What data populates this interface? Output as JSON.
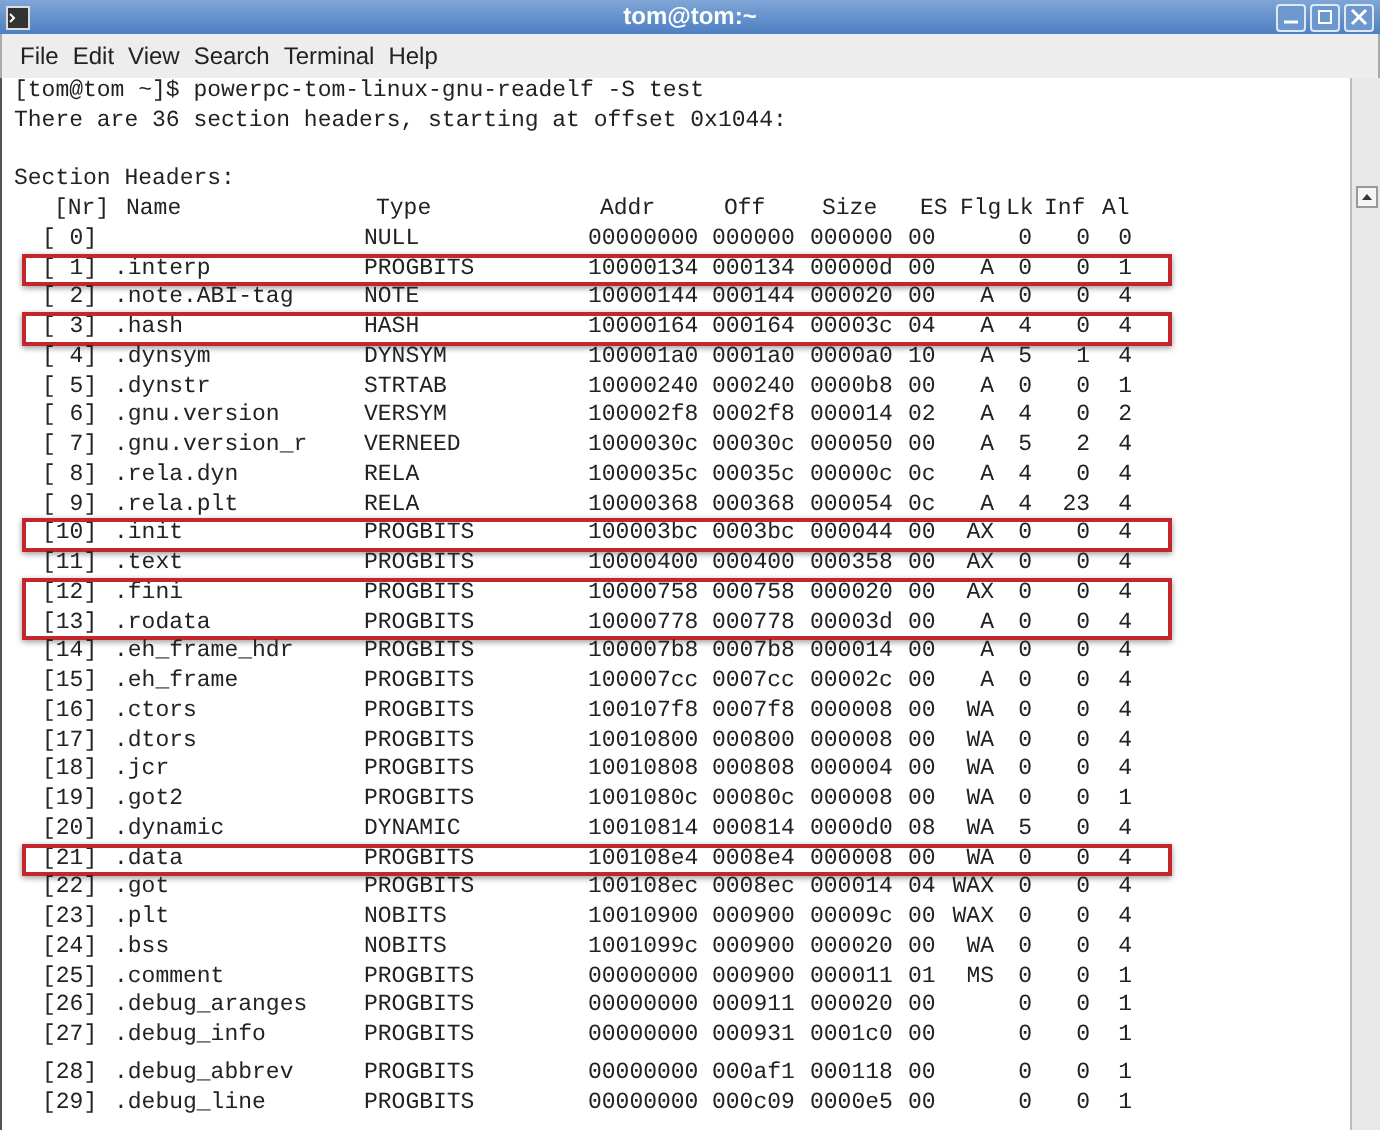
{
  "window": {
    "title": "tom@tom:~"
  },
  "menu": [
    "File",
    "Edit",
    "View",
    "Search",
    "Terminal",
    "Help"
  ],
  "terminal": {
    "output_lines": [
      "[tom@tom ~]$ powerpc-tom-linux-gnu-readelf -S test",
      "There are 36 section headers, starting at offset 0x1044:"
    ],
    "heading": "Section Headers:",
    "table": {
      "columns": [
        "[Nr]",
        "Name",
        "Type",
        "Addr",
        "Off",
        "Size",
        "ES",
        "Flg",
        "Lk",
        "Inf",
        "Al"
      ],
      "row_groups": [
        [
          {
            "cells": [
              "[ 0]",
              "",
              "NULL",
              "00000000",
              "000000",
              "000000",
              "00",
              "",
              "0",
              "0",
              "0"
            ],
            "highlighted": false
          },
          {
            "cells": [
              "[ 1]",
              ".interp",
              "PROGBITS",
              "10000134",
              "000134",
              "00000d",
              "00",
              "A",
              "0",
              "0",
              "1"
            ],
            "highlighted": true
          },
          {
            "cells": [
              "[ 2]",
              ".note.ABI-tag",
              "NOTE",
              "10000144",
              "000144",
              "000020",
              "00",
              "A",
              "0",
              "0",
              "4"
            ],
            "highlighted": false
          },
          {
            "cells": [
              "[ 3]",
              ".hash",
              "HASH",
              "10000164",
              "000164",
              "00003c",
              "04",
              "A",
              "4",
              "0",
              "4"
            ],
            "highlighted": true
          },
          {
            "cells": [
              "[ 4]",
              ".dynsym",
              "DYNSYM",
              "100001a0",
              "0001a0",
              "0000a0",
              "10",
              "A",
              "5",
              "1",
              "4"
            ],
            "highlighted": false
          },
          {
            "cells": [
              "[ 5]",
              ".dynstr",
              "STRTAB",
              "10000240",
              "000240",
              "0000b8",
              "00",
              "A",
              "0",
              "0",
              "1"
            ],
            "highlighted": false
          },
          {
            "cells": [
              "[ 6]",
              ".gnu.version",
              "VERSYM",
              "100002f8",
              "0002f8",
              "000014",
              "02",
              "A",
              "4",
              "0",
              "2"
            ],
            "highlighted": false
          },
          {
            "cells": [
              "[ 7]",
              ".gnu.version_r",
              "VERNEED",
              "1000030c",
              "00030c",
              "000050",
              "00",
              "A",
              "5",
              "2",
              "4"
            ],
            "highlighted": false
          },
          {
            "cells": [
              "[ 8]",
              ".rela.dyn",
              "RELA",
              "1000035c",
              "00035c",
              "00000c",
              "0c",
              "A",
              "4",
              "0",
              "4"
            ],
            "highlighted": false
          },
          {
            "cells": [
              "[ 9]",
              ".rela.plt",
              "RELA",
              "10000368",
              "000368",
              "000054",
              "0c",
              "A",
              "4",
              "23",
              "4"
            ],
            "highlighted": false
          },
          {
            "cells": [
              "[10]",
              ".init",
              "PROGBITS",
              "100003bc",
              "0003bc",
              "000044",
              "00",
              "AX",
              "0",
              "0",
              "4"
            ],
            "highlighted": true
          },
          {
            "cells": [
              "[11]",
              ".text",
              "PROGBITS",
              "10000400",
              "000400",
              "000358",
              "00",
              "AX",
              "0",
              "0",
              "4"
            ],
            "highlighted": false
          },
          {
            "cells": [
              "[12]",
              ".fini",
              "PROGBITS",
              "10000758",
              "000758",
              "000020",
              "00",
              "AX",
              "0",
              "0",
              "4"
            ],
            "highlighted": true
          },
          {
            "cells": [
              "[13]",
              ".rodata",
              "PROGBITS",
              "10000778",
              "000778",
              "00003d",
              "00",
              "A",
              "0",
              "0",
              "4"
            ],
            "highlighted": true
          },
          {
            "cells": [
              "[14]",
              ".eh_frame_hdr",
              "PROGBITS",
              "100007b8",
              "0007b8",
              "000014",
              "00",
              "A",
              "0",
              "0",
              "4"
            ],
            "highlighted": false
          },
          {
            "cells": [
              "[15]",
              ".eh_frame",
              "PROGBITS",
              "100007cc",
              "0007cc",
              "00002c",
              "00",
              "A",
              "0",
              "0",
              "4"
            ],
            "highlighted": false
          },
          {
            "cells": [
              "[16]",
              ".ctors",
              "PROGBITS",
              "100107f8",
              "0007f8",
              "000008",
              "00",
              "WA",
              "0",
              "0",
              "4"
            ],
            "highlighted": false
          },
          {
            "cells": [
              "[17]",
              ".dtors",
              "PROGBITS",
              "10010800",
              "000800",
              "000008",
              "00",
              "WA",
              "0",
              "0",
              "4"
            ],
            "highlighted": false
          },
          {
            "cells": [
              "[18]",
              ".jcr",
              "PROGBITS",
              "10010808",
              "000808",
              "000004",
              "00",
              "WA",
              "0",
              "0",
              "4"
            ],
            "highlighted": false
          },
          {
            "cells": [
              "[19]",
              ".got2",
              "PROGBITS",
              "1001080c",
              "00080c",
              "000008",
              "00",
              "WA",
              "0",
              "0",
              "1"
            ],
            "highlighted": false
          },
          {
            "cells": [
              "[20]",
              ".dynamic",
              "DYNAMIC",
              "10010814",
              "000814",
              "0000d0",
              "08",
              "WA",
              "5",
              "0",
              "4"
            ],
            "highlighted": false
          },
          {
            "cells": [
              "[21]",
              ".data",
              "PROGBITS",
              "100108e4",
              "0008e4",
              "000008",
              "00",
              "WA",
              "0",
              "0",
              "4"
            ],
            "highlighted": true
          },
          {
            "cells": [
              "[22]",
              ".got",
              "PROGBITS",
              "100108ec",
              "0008ec",
              "000014",
              "04",
              "WAX",
              "0",
              "0",
              "4"
            ],
            "highlighted": false
          },
          {
            "cells": [
              "[23]",
              ".plt",
              "NOBITS",
              "10010900",
              "000900",
              "00009c",
              "00",
              "WAX",
              "0",
              "0",
              "4"
            ],
            "highlighted": false
          },
          {
            "cells": [
              "[24]",
              ".bss",
              "NOBITS",
              "1001099c",
              "000900",
              "000020",
              "00",
              "WA",
              "0",
              "0",
              "4"
            ],
            "highlighted": false
          },
          {
            "cells": [
              "[25]",
              ".comment",
              "PROGBITS",
              "00000000",
              "000900",
              "000011",
              "01",
              "MS",
              "0",
              "0",
              "1"
            ],
            "highlighted": false
          },
          {
            "cells": [
              "[26]",
              ".debug_aranges",
              "PROGBITS",
              "00000000",
              "000911",
              "000020",
              "00",
              "",
              "0",
              "0",
              "1"
            ],
            "highlighted": false
          },
          {
            "cells": [
              "[27]",
              ".debug_info",
              "PROGBITS",
              "00000000",
              "000931",
              "0001c0",
              "00",
              "",
              "0",
              "0",
              "1"
            ],
            "highlighted": false
          }
        ],
        [
          {
            "cells": [
              "[28]",
              ".debug_abbrev",
              "PROGBITS",
              "00000000",
              "000af1",
              "000118",
              "00",
              "",
              "0",
              "0",
              "1"
            ],
            "highlighted": false
          },
          {
            "cells": [
              "[29]",
              ".debug_line",
              "PROGBITS",
              "00000000",
              "000c09",
              "0000e5",
              "00",
              "",
              "0",
              "0",
              "1"
            ],
            "highlighted": false
          }
        ]
      ]
    }
  }
}
